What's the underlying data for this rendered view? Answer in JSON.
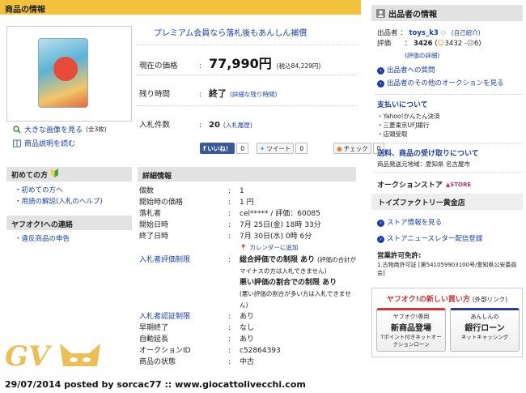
{
  "product_header": "商品の情報",
  "image_links": {
    "large_image": "大きな画像を見る",
    "large_image_count": "(全3枚)",
    "description": "商品説明を読む"
  },
  "promo": "プレミアム会員なら落札後もあんしん補償",
  "price": {
    "label": "現在の価格",
    "colon": ":",
    "value": "77,990円",
    "tax": "(税込84,229円)"
  },
  "remaining": {
    "label": "残り時間",
    "colon": ":",
    "value": "終了",
    "detail": "(詳細な残り時間)"
  },
  "bids": {
    "label": "入札件数",
    "colon": ":",
    "value": "20",
    "history": "(入札履歴)"
  },
  "social": {
    "like": "いいね！",
    "like_count": "0",
    "tweet": "ツイート",
    "tweet_count": "0",
    "check": "チェック",
    "check_count": "0"
  },
  "sidebar_left": {
    "beginner_title": "初めての方",
    "beginner_items": [
      "初めての方へ",
      "用語の解説(入札のヘルプ)"
    ],
    "contact_title": "ヤフオク!への連絡",
    "contact_items": [
      "違反商品の申告"
    ]
  },
  "details": {
    "header": "詳細情報",
    "rows": [
      {
        "key": "個数",
        "value": "1"
      },
      {
        "key": "開始時の価格",
        "value": "1 円"
      },
      {
        "key": "落札者",
        "value": "cel***** / 評価：60085"
      },
      {
        "key": "開始日時",
        "value": "7月 25日(金) 18時 33分"
      },
      {
        "key": "終了日時",
        "value": "7月 30日(水) 0時 6分"
      }
    ],
    "calendar": "カレンダーに追加",
    "eval_limit_key": "入札者評価制限",
    "eval_limit_1": "総合評価での制限 あり",
    "eval_limit_1_note": "(評価の合計がマイナスの方は入札できません)",
    "eval_limit_2": "悪い評価の割合での制限 あり",
    "eval_limit_2_note": "(悪い評価の割合が多い方は入札できません)",
    "rows2": [
      {
        "key": "入札者認証制限",
        "value": "あり",
        "link": true
      },
      {
        "key": "早期終了",
        "value": "なし",
        "link": false
      },
      {
        "key": "自動延長",
        "value": "あり",
        "link": false
      },
      {
        "key": "オークションID",
        "value": "c52864393",
        "link": false
      },
      {
        "key": "商品の状態",
        "value": "中古",
        "link": false
      }
    ],
    "colon": ":"
  },
  "seller": {
    "header": "出品者の情報",
    "seller_label": "出品者",
    "seller_id": "toys_k3",
    "self_intro": "(自己紹介)",
    "rating_label": "評価",
    "rating_total": "3426",
    "rating_good": "3432",
    "rating_bad": "6",
    "rating_detail": "(評価の詳細)",
    "question_link": "出品者への質問",
    "other_auctions": "出品者のその他のオークションを見る",
    "payment_title": "支払いについて",
    "payment_items": [
      "Yahoo!かんたん決済",
      "三菱東京UFJ銀行",
      "店頭受取"
    ],
    "shipping_title": "送料、商品の受け取りについて",
    "shipping_area": "商品発送元地域：愛知県 名古屋市",
    "store_title": "オークションストア",
    "store_badge": "STORE",
    "store_name": "トイズファクトリー黄金店",
    "store_info": "ストア情報を見る",
    "newsletter": "ストアニュースレター配信登録",
    "license_title": "営業許可免許:",
    "license_text": "1.古物商許可証 [第541059903100号/愛知県公安委員会]"
  },
  "new_buy": {
    "title": "ヤフオク!の新しい買い方",
    "external": "(外部リンク)",
    "btn1_top": "ヤフオク!専用",
    "btn1_main": "新商品登場",
    "btn1_sub": "Tポイント付きネットオークションローン",
    "btn2_top": "あんしんの",
    "btn2_main": "銀行ローン",
    "btn2_sub": "ネットキャッシング"
  },
  "watermark": {
    "logo": "GV",
    "caption": "29/07/2014 posted by sorcac77 :: www.giocattolivecchi.com"
  },
  "colors": {
    "yellow_header": "#f2c23c",
    "link_blue": "#1a3fa8",
    "gray_header": "#e2e2e2"
  }
}
